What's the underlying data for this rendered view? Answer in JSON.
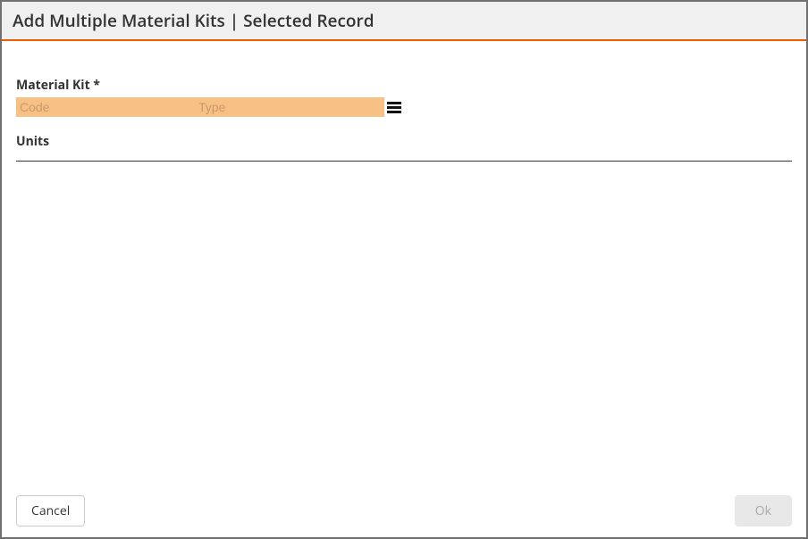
{
  "header": {
    "title": "Add Multiple Material Kits | Selected Record"
  },
  "form": {
    "materialKit": {
      "label": "Material Kit *",
      "codePlaceholder": "Code",
      "typePlaceholder": "Type",
      "codeValue": "",
      "typeValue": ""
    },
    "units": {
      "label": "Units"
    }
  },
  "footer": {
    "cancelLabel": "Cancel",
    "okLabel": "Ok"
  }
}
